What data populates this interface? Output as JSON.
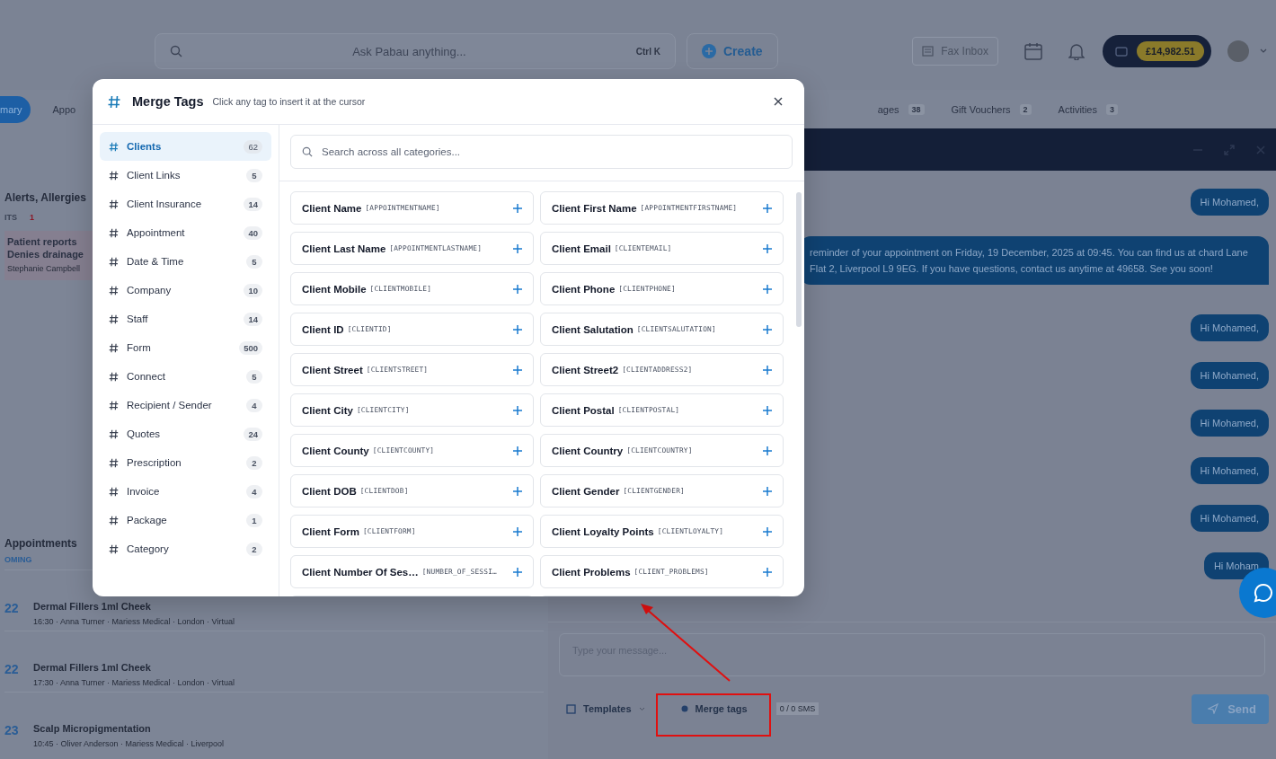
{
  "topbar": {
    "search": {
      "placeholder": "Ask Pabau anything...",
      "shortcut": "Ctrl K"
    },
    "create_label": "Create",
    "fax_label": "Fax Inbox",
    "balance": "£14,982.51"
  },
  "tabs": [
    {
      "label": "mary",
      "selected": true
    },
    {
      "label": "Appo",
      "selected": false
    },
    {
      "label": "ages",
      "count": "38",
      "selected": false
    },
    {
      "label": "Gift Vouchers",
      "count": "2",
      "selected": false
    },
    {
      "label": "Activities",
      "count": "3",
      "selected": false
    }
  ],
  "alerts": {
    "title": "Alerts, Allergies",
    "subtitle": "ITS",
    "count": "1",
    "note_lines": [
      "Patient reports",
      "Denies drainage"
    ],
    "note_author": "Stephanie Campbell"
  },
  "appointments": {
    "title": "Appointments",
    "subtitle": "OMING",
    "rows": [
      {
        "day": "22",
        "title": "Dermal Fillers 1ml Cheek",
        "details": "16:30 · Anna Turner · Mariess Medical · London · Virtual"
      },
      {
        "day": "22",
        "title": "Dermal Fillers 1ml Cheek",
        "details": "17:30 · Anna Turner · Mariess Medical · London · Virtual"
      },
      {
        "day": "23",
        "title": "Scalp Micropigmentation",
        "details": "10:45 · Oliver Anderson · Mariess Medical · Liverpool"
      }
    ]
  },
  "chat": {
    "messages": [
      {
        "kind": "short",
        "text": "Hi Mohamed,"
      },
      {
        "kind": "long",
        "text": "reminder of your appointment on Friday, 19 December, 2025 at 09:45. You can find us at chard Lane Flat 2, Liverpool  L9 9EG. If you have questions, contact us anytime at 49658. See you soon!"
      },
      {
        "kind": "short",
        "text": "Hi Mohamed,"
      },
      {
        "kind": "short",
        "text": "Hi Mohamed,"
      },
      {
        "kind": "short",
        "text": "Hi Mohamed,"
      },
      {
        "kind": "short",
        "text": "Hi Mohamed,"
      },
      {
        "kind": "short",
        "text": "Hi Mohamed,"
      },
      {
        "kind": "short",
        "text": "Hi Moham"
      }
    ],
    "composer": {
      "placeholder": "Type your message...",
      "templates_label": "Templates",
      "merge_tags_label": "Merge tags",
      "sms_count": "0 / 0 SMS",
      "send_label": "Send"
    }
  },
  "modal": {
    "title": "Merge Tags",
    "hint": "Click any tag to insert it at the cursor",
    "categories": [
      {
        "label": "Clients",
        "count": "62",
        "selected": true
      },
      {
        "label": "Client Links",
        "count": "5",
        "selected": false
      },
      {
        "label": "Client Insurance",
        "count": "14",
        "selected": false
      },
      {
        "label": "Appointment",
        "count": "40",
        "selected": false
      },
      {
        "label": "Date & Time",
        "count": "5",
        "selected": false
      },
      {
        "label": "Company",
        "count": "10",
        "selected": false
      },
      {
        "label": "Staff",
        "count": "14",
        "selected": false
      },
      {
        "label": "Form",
        "count": "500",
        "selected": false
      },
      {
        "label": "Connect",
        "count": "5",
        "selected": false
      },
      {
        "label": "Recipient / Sender",
        "count": "4",
        "selected": false
      },
      {
        "label": "Quotes",
        "count": "24",
        "selected": false
      },
      {
        "label": "Prescription",
        "count": "2",
        "selected": false
      },
      {
        "label": "Invoice",
        "count": "4",
        "selected": false
      },
      {
        "label": "Package",
        "count": "1",
        "selected": false
      },
      {
        "label": "Category",
        "count": "2",
        "selected": false
      }
    ],
    "search_placeholder": "Search across all categories...",
    "tags": [
      {
        "label": "Client Name",
        "code": "[APPOINTMENTNAME]"
      },
      {
        "label": "Client First Name",
        "code": "[APPOINTMENTFIRSTNAME]"
      },
      {
        "label": "Client Last Name",
        "code": "[APPOINTMENTLASTNAME]"
      },
      {
        "label": "Client Email",
        "code": "[CLIENTEMAIL]"
      },
      {
        "label": "Client Mobile",
        "code": "[CLIENTMOBILE]"
      },
      {
        "label": "Client Phone",
        "code": "[CLIENTPHONE]"
      },
      {
        "label": "Client ID",
        "code": "[CLIENTID]"
      },
      {
        "label": "Client Salutation",
        "code": "[CLIENTSALUTATION]"
      },
      {
        "label": "Client Street",
        "code": "[CLIENTSTREET]"
      },
      {
        "label": "Client Street2",
        "code": "[CLIENTADDRESS2]"
      },
      {
        "label": "Client City",
        "code": "[CLIENTCITY]"
      },
      {
        "label": "Client Postal",
        "code": "[CLIENTPOSTAL]"
      },
      {
        "label": "Client County",
        "code": "[CLIENTCOUNTY]"
      },
      {
        "label": "Client Country",
        "code": "[CLIENTCOUNTRY]"
      },
      {
        "label": "Client DOB",
        "code": "[CLIENTDOB]"
      },
      {
        "label": "Client Gender",
        "code": "[CLIENTGENDER]"
      },
      {
        "label": "Client Form",
        "code": "[CLIENTFORM]"
      },
      {
        "label": "Client Loyalty Points",
        "code": "[CLIENTLOYALTY]"
      },
      {
        "label": "Client Number Of Ses…",
        "code": "[NUMBER_OF_SESSI…"
      },
      {
        "label": "Client Problems",
        "code": "[CLIENT_PROBLEMS]"
      }
    ]
  }
}
